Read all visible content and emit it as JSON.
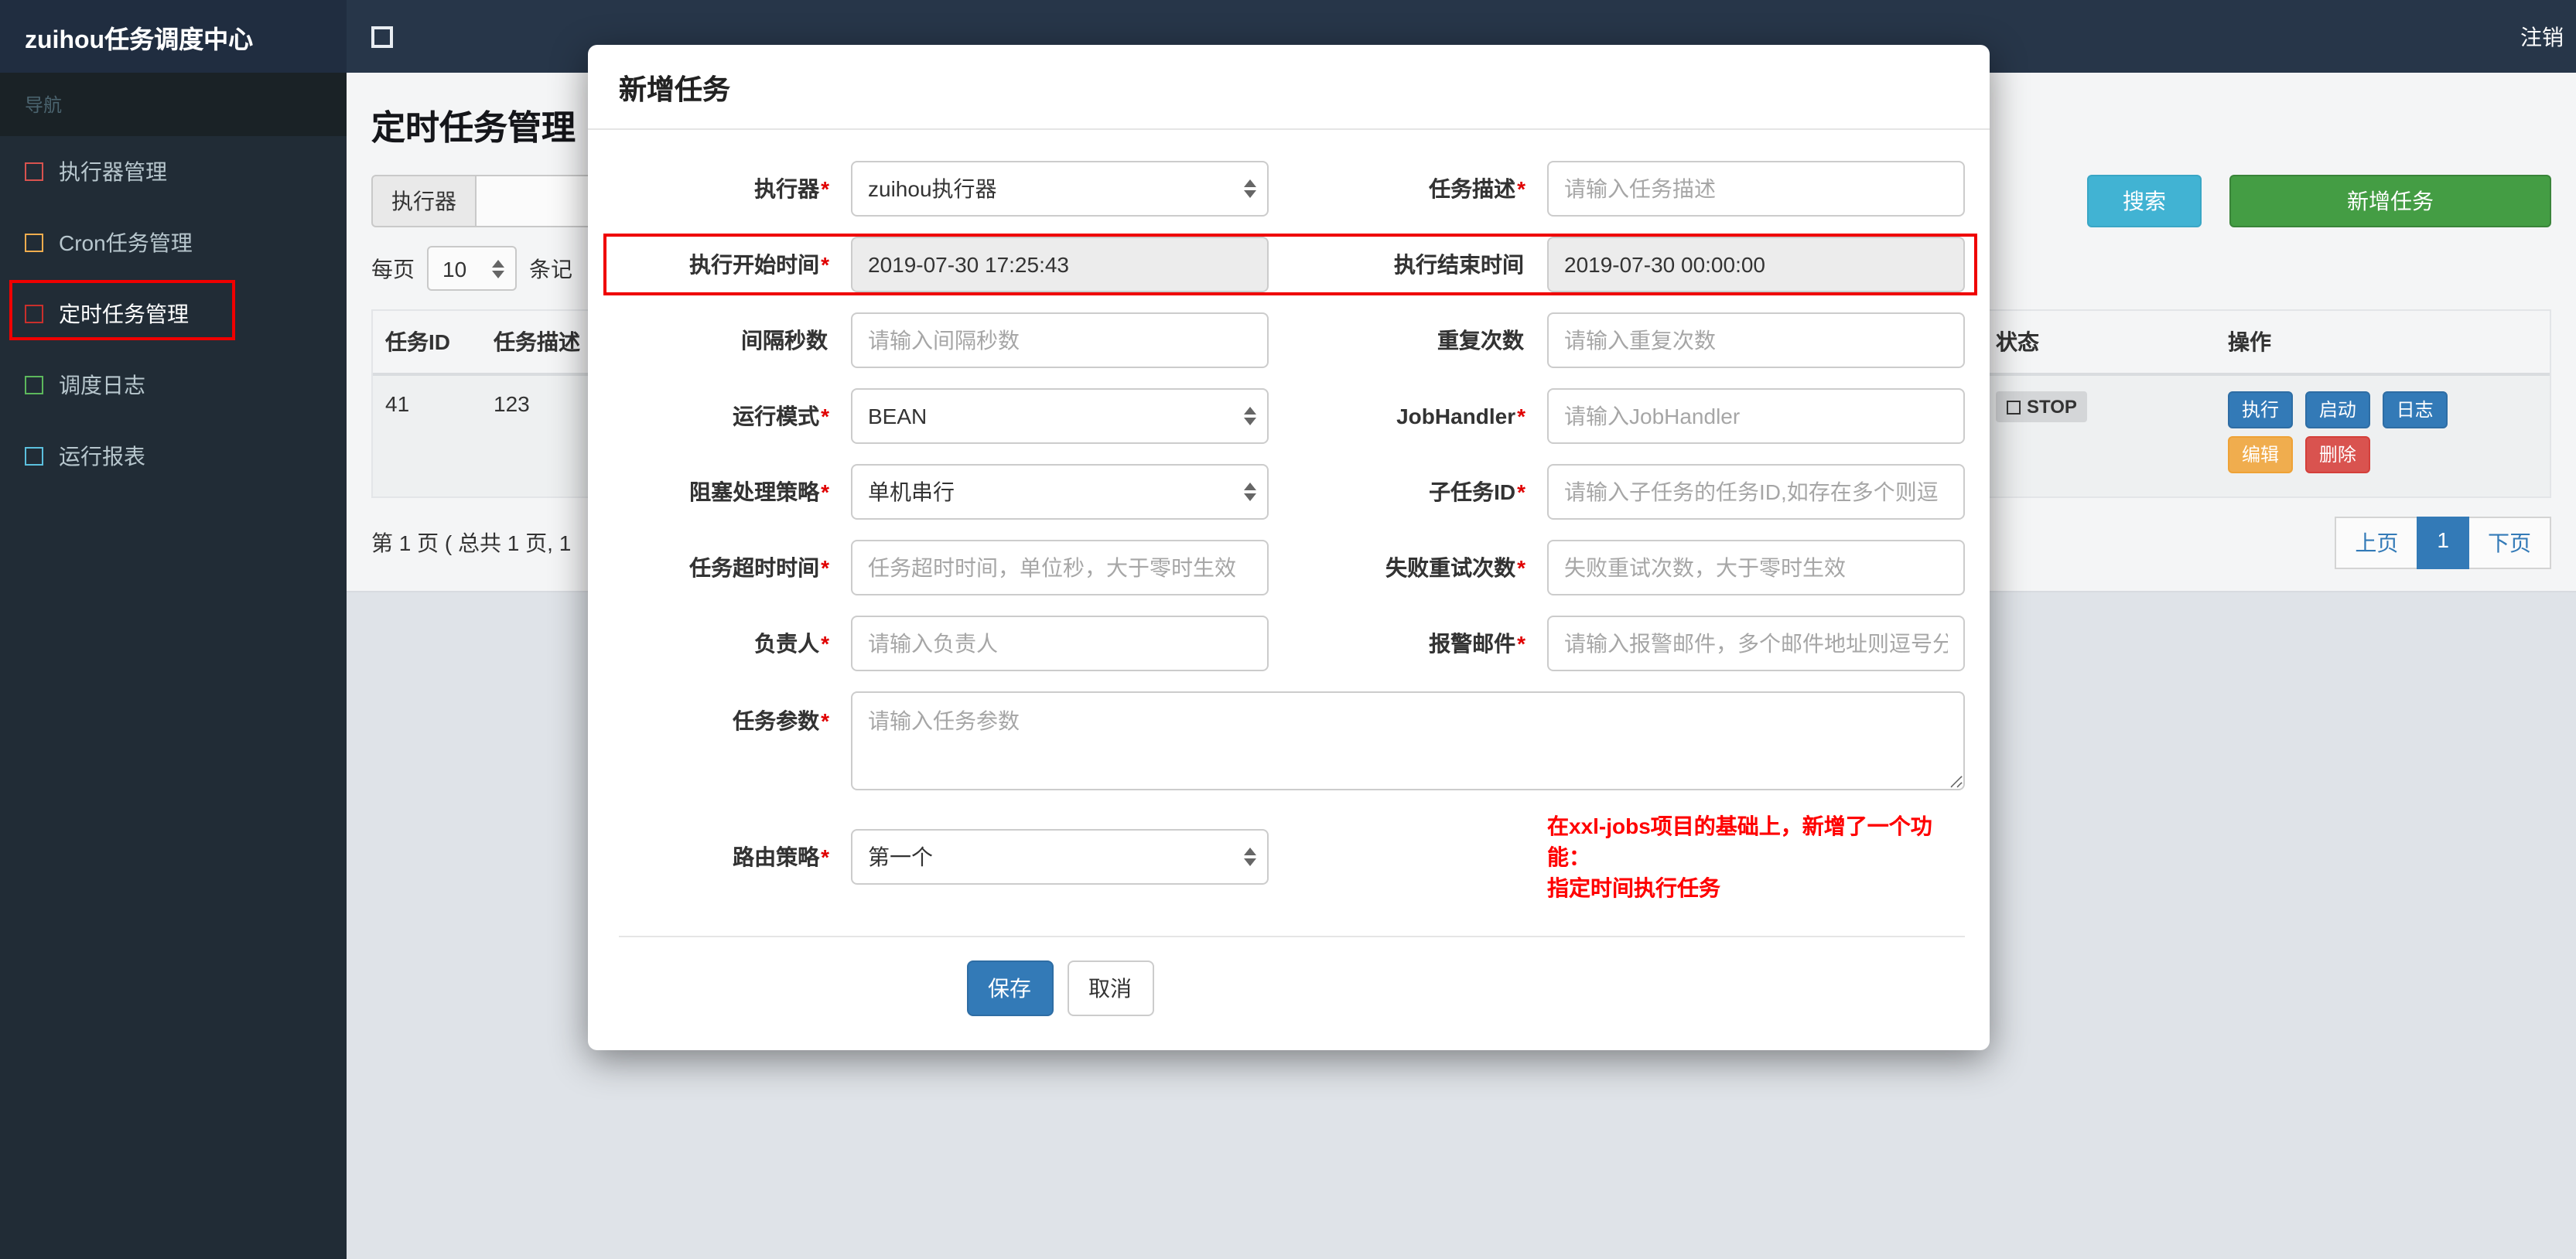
{
  "navbar": {
    "brand": "zuihou任务调度中心",
    "logout": "注销"
  },
  "sidebar": {
    "header": "导航",
    "items": [
      {
        "label": "执行器管理",
        "icon_color": "#d9534f",
        "active": false
      },
      {
        "label": "Cron任务管理",
        "icon_color": "#f0ad4e",
        "active": false
      },
      {
        "label": "定时任务管理",
        "icon_color": "#c9302c",
        "active": true
      },
      {
        "label": "调度日志",
        "icon_color": "#5cb85c",
        "active": false
      },
      {
        "label": "运行报表",
        "icon_color": "#5bc0de",
        "active": false
      }
    ]
  },
  "page": {
    "title": "定时任务管理",
    "filter": {
      "executor_label": "执行器",
      "search_button": "搜索",
      "add_button": "新增任务"
    },
    "per_page": {
      "prefix": "每页",
      "value": "10",
      "suffix": "条记"
    },
    "table": {
      "headers": {
        "id": "任务ID",
        "desc": "任务描述",
        "status": "状态",
        "ops": "操作"
      },
      "row": {
        "id": "41",
        "desc": "123",
        "status": "STOP",
        "actions": [
          "执行",
          "启动",
          "日志",
          "编辑",
          "删除"
        ]
      }
    },
    "pagination": {
      "summary": "第 1 页 ( 总共 1 页, 1",
      "prev": "上页",
      "current": "1",
      "next": "下页"
    }
  },
  "modal": {
    "title": "新增任务",
    "rows": [
      {
        "left": {
          "label": "执行器",
          "required": "*",
          "value": "zuihou执行器"
        },
        "right": {
          "label": "任务描述",
          "required": "*",
          "placeholder": "请输入任务描述"
        }
      },
      {
        "left": {
          "label": "执行开始时间",
          "required": "*",
          "value": "2019-07-30 17:25:43"
        },
        "right": {
          "label": "执行结束时间",
          "required": "",
          "value": "2019-07-30 00:00:00"
        }
      },
      {
        "left": {
          "label": "间隔秒数",
          "required": "",
          "placeholder": "请输入间隔秒数"
        },
        "right": {
          "label": "重复次数",
          "required": "",
          "placeholder": "请输入重复次数"
        }
      },
      {
        "left": {
          "label": "运行模式",
          "required": "*",
          "value": "BEAN"
        },
        "right": {
          "label": "JobHandler",
          "required": "*",
          "placeholder": "请输入JobHandler"
        }
      },
      {
        "left": {
          "label": "阻塞处理策略",
          "required": "*",
          "value": "单机串行"
        },
        "right": {
          "label": "子任务ID",
          "required": "*",
          "placeholder": "请输入子任务的任务ID,如存在多个则逗"
        }
      },
      {
        "left": {
          "label": "任务超时时间",
          "required": "*",
          "placeholder": "任务超时时间，单位秒，大于零时生效"
        },
        "right": {
          "label": "失败重试次数",
          "required": "*",
          "placeholder": "失败重试次数，大于零时生效"
        }
      },
      {
        "left": {
          "label": "负责人",
          "required": "*",
          "placeholder": "请输入负责人"
        },
        "right": {
          "label": "报警邮件",
          "required": "*",
          "placeholder": "请输入报警邮件，多个邮件地址则逗号分"
        }
      }
    ],
    "params": {
      "label": "任务参数",
      "required": "*",
      "placeholder": "请输入任务参数"
    },
    "routing": {
      "label": "路由策略",
      "required": "*",
      "value": "第一个"
    },
    "note": {
      "line1": "在xxl-jobs项目的基础上，新增了一个功能：",
      "line2": "指定时间执行任务"
    },
    "footer": {
      "save": "保存",
      "cancel": "取消"
    }
  },
  "colors": {
    "annotation_red": "#ef0000",
    "primary_blue": "#337ab7",
    "search_teal": "#41b3d3",
    "add_green": "#449d44",
    "warning_orange": "#f0ad4e",
    "danger_red": "#d9534f",
    "status_stop_bg": "#d4d6d8"
  }
}
